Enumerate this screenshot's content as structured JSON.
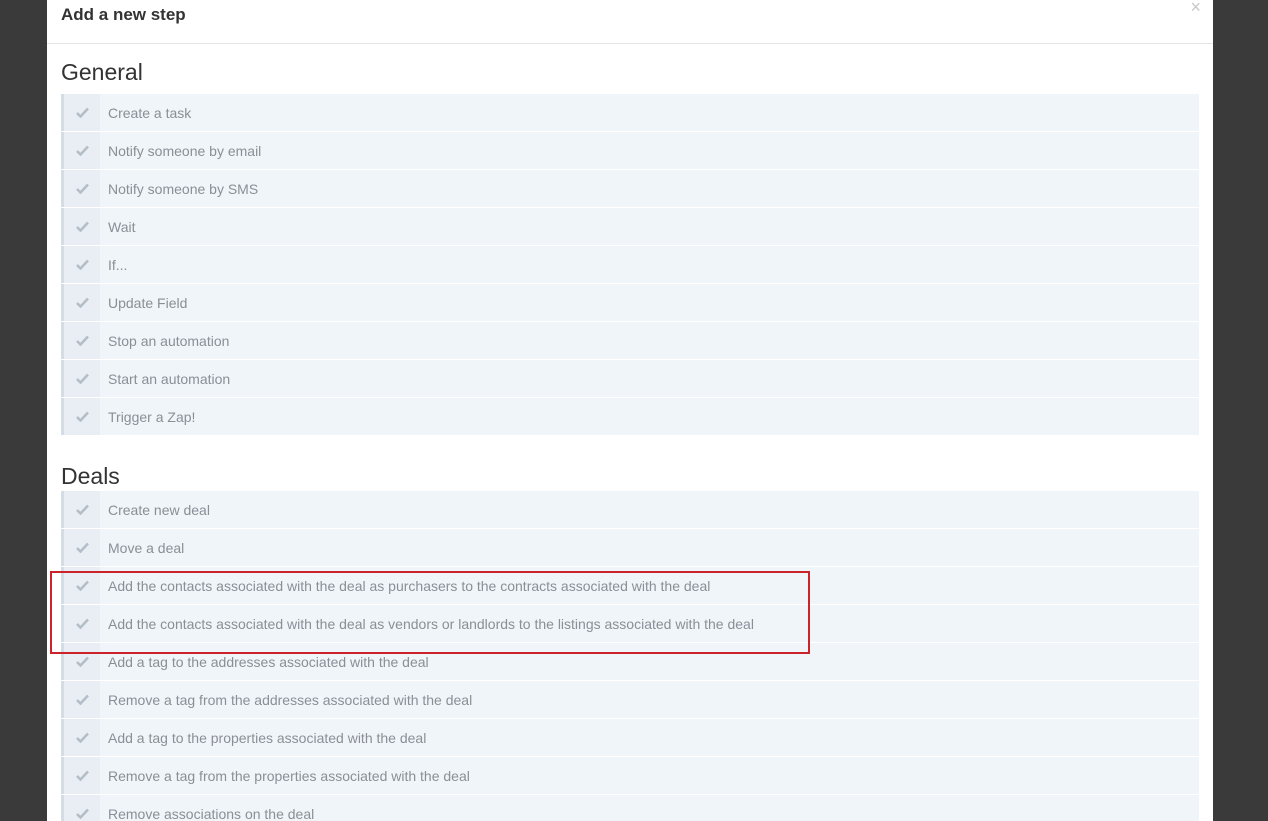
{
  "modal": {
    "title": "Add a new step",
    "close_symbol": "×"
  },
  "sections": [
    {
      "title": "General",
      "items": [
        "Create a task",
        "Notify someone by email",
        "Notify someone by SMS",
        "Wait",
        "If...",
        "Update Field",
        "Stop an automation",
        "Start an automation",
        "Trigger a Zap!"
      ]
    },
    {
      "title": "Deals",
      "items": [
        "Create new deal",
        "Move a deal",
        "Add the contacts associated with the deal as purchasers to the contracts associated with the deal",
        "Add the contacts associated with the deal as vendors or landlords to the listings associated with the deal",
        "Add a tag to the addresses associated with the deal",
        "Remove a tag from the addresses associated with the deal",
        "Add a tag to the properties associated with the deal",
        "Remove a tag from the properties associated with the deal",
        "Remove associations on the deal"
      ]
    }
  ],
  "colors": {
    "highlight": "#cc2229",
    "item_background": "#f0f5fa",
    "check_color": "#b4bec9"
  }
}
